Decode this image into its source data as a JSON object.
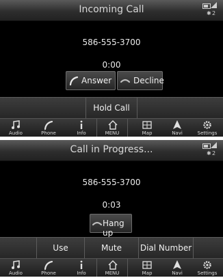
{
  "screens": [
    {
      "title": "Incoming Call",
      "number": "586-555-3700",
      "timer": "0:00",
      "answer_label": "Answer",
      "decline_label": "Decline",
      "hold_label": "Hold Call"
    },
    {
      "title": "Call in Progress...",
      "number": "586-555-3700",
      "timer": "0:03",
      "hangup_label": "Hang up",
      "actions": [
        "Use Handset",
        "Mute",
        "Dial Number"
      ]
    }
  ],
  "status": {
    "bluetooth": "✱",
    "count": "2"
  },
  "nav": [
    {
      "label": "Audio",
      "icon": "music-note-icon"
    },
    {
      "label": "Phone",
      "icon": "phone-icon"
    },
    {
      "label": "Info",
      "icon": "info-icon"
    },
    {
      "label": "MENU",
      "icon": "home-icon"
    },
    {
      "label": "Map",
      "icon": "map-icon"
    },
    {
      "label": "Navi",
      "icon": "navigation-arrow-icon"
    },
    {
      "label": "Settings",
      "icon": "gear-icon"
    }
  ],
  "colors": {
    "screen_bg": "#000000",
    "bar_bg": "#2e2e2e",
    "text": "#ececec"
  }
}
